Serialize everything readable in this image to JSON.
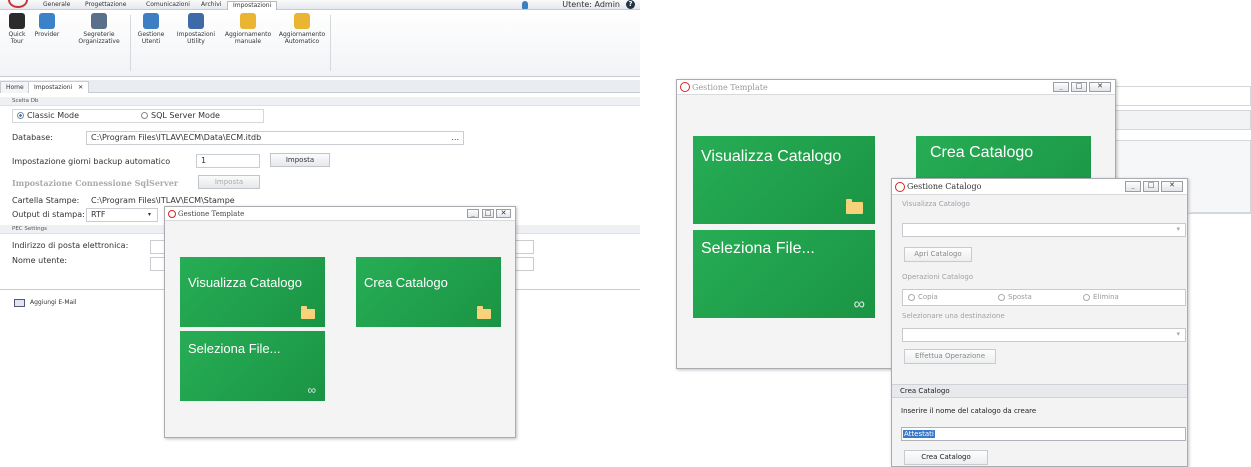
{
  "app": {
    "menu_tabs": [
      "Generale",
      "Progettazione",
      "Comunicazioni",
      "Archivi",
      "Impostazioni"
    ],
    "user_label": "Utente: Admin",
    "help": "?",
    "ribbon": [
      {
        "label": "Quick\nTour",
        "icon": "tshirt-icon",
        "color": "#2b2b2b"
      },
      {
        "label": "Provider",
        "icon": "provider-icon",
        "color": "#3a83c9"
      },
      {
        "label": "Segreterie\nOrganizzative",
        "icon": "people-icon",
        "color": "#5a6f8a"
      },
      {
        "label": "Gestione\nUtenti",
        "icon": "users-icon",
        "color": "#3d7fc2"
      },
      {
        "label": "Impostazioni\nUtility",
        "icon": "handshake-icon",
        "color": "#3e6aa8"
      },
      {
        "label": "Aggiornamento\nmanuale",
        "icon": "update-manual-icon",
        "color": "#e9b533"
      },
      {
        "label": "Aggiornamento\nAutomatico",
        "icon": "update-auto-icon",
        "color": "#e9b533"
      }
    ],
    "doc_tabs": [
      "Home",
      "Impostazioni"
    ],
    "close_glyph": "✕",
    "scelta_db": "Scelta Db",
    "classic_mode": "Classic Mode",
    "sql_mode": "SQL Server Mode",
    "database_label": "Database:",
    "database_value": "C:\\Program Files\\ITLAV\\ECM\\Data\\ECM.itdb",
    "ellipsis": "...",
    "backup_label": "Impostazione giorni backup automatico",
    "backup_value": "1",
    "imposta": "Imposta",
    "sql_conn_label": "Impostazione Connessione SqlServer",
    "cartella_label": "Cartella Stampe:",
    "cartella_value": "C:\\Program Files\\ITLAV\\ECM\\Stampe",
    "output_label": "Output di stampa:",
    "output_value": "RTF",
    "pec_settings": "PEC Settings",
    "email_label": "Indirizzo di posta elettronica:",
    "username_label": "Nome utente:",
    "add_email": "Aggiungi E-Mail"
  },
  "template_window_small": {
    "title": "Gestione Template",
    "controls": [
      "_",
      "□",
      "✕"
    ],
    "tiles": [
      "Visualizza Catalogo",
      "Crea Catalogo",
      "Seleziona File..."
    ]
  },
  "template_window_large": {
    "title": "Gestione Template",
    "controls": [
      "_",
      "□",
      "✕"
    ],
    "tiles": [
      "Visualizza Catalogo",
      "Crea Catalogo",
      "Seleziona File..."
    ]
  },
  "catalogo_window": {
    "title": "Gestione Catalogo",
    "controls": [
      "_",
      "□",
      "✕"
    ],
    "visualizza_label": "Visualizza Catalogo",
    "apri_button": "Apri Catalogo",
    "operazioni_label": "Operazioni Catalogo",
    "ops": [
      "Copia",
      "Sposta",
      "Elimina"
    ],
    "destinazione_label": "Selezionare una destinazione",
    "effettua_button": "Effettua Operazione",
    "crea_header": "Crea Catalogo",
    "crea_prompt": "Inserire il nome del catalogo da creare",
    "crea_value": "Attestati",
    "crea_button": "Crea Catalogo"
  }
}
